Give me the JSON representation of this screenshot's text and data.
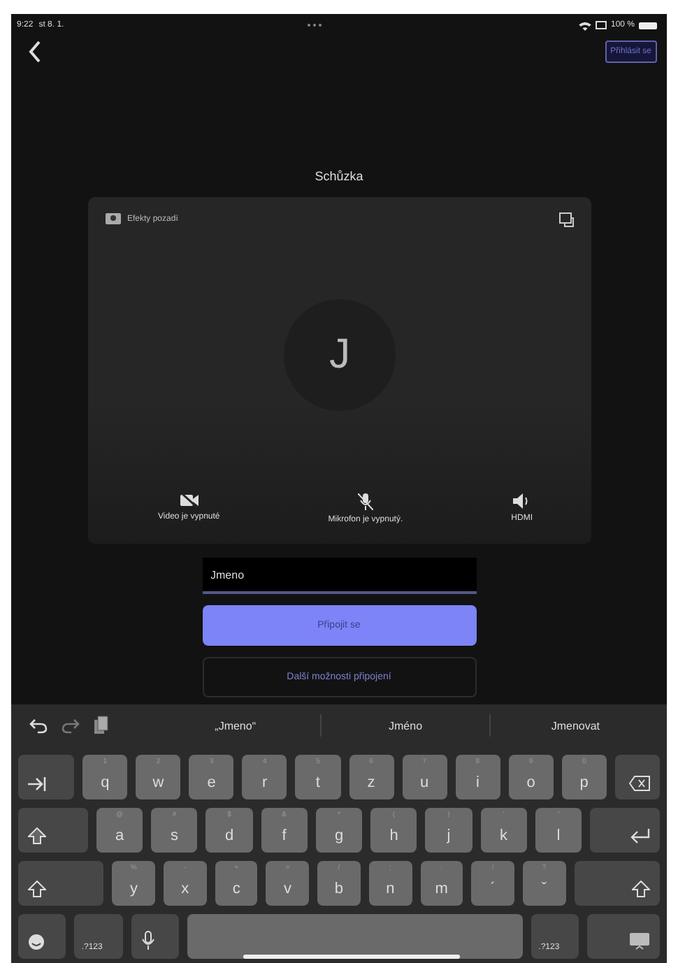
{
  "status_bar": {
    "time": "9:22",
    "date": "st 8. 1.",
    "battery": "100 %"
  },
  "top_bar": {
    "login_button": "Přihlásit se"
  },
  "title": "Schůzka",
  "preview": {
    "background_effects": "Efekty pozadí",
    "avatar_initial": "J",
    "controls": [
      {
        "label": "Video je vypnuté",
        "kind": "video_off"
      },
      {
        "label": "Mikrofon je vypnutý.",
        "kind": "mic_off"
      },
      {
        "label": "HDMI",
        "kind": "speaker"
      }
    ]
  },
  "name_field": {
    "value": "Jmeno"
  },
  "join_button": "Připojit se",
  "more_options_button": "Další možnosti připojení",
  "keyboard": {
    "suggestions": [
      "„Jmeno“",
      "Jméno",
      "Jmenovat"
    ],
    "rows": [
      {
        "keys": [
          {
            "kind": "tab"
          },
          {
            "kind": "letter",
            "label": "q",
            "hint": "1"
          },
          {
            "kind": "letter",
            "label": "w",
            "hint": "2"
          },
          {
            "kind": "letter",
            "label": "e",
            "hint": "3"
          },
          {
            "kind": "letter",
            "label": "r",
            "hint": "4"
          },
          {
            "kind": "letter",
            "label": "t",
            "hint": "5"
          },
          {
            "kind": "letter",
            "label": "z",
            "hint": "6"
          },
          {
            "kind": "letter",
            "label": "u",
            "hint": "7"
          },
          {
            "kind": "letter",
            "label": "i",
            "hint": "8"
          },
          {
            "kind": "letter",
            "label": "o",
            "hint": "9"
          },
          {
            "kind": "letter",
            "label": "p",
            "hint": "0"
          },
          {
            "kind": "backspace"
          }
        ]
      },
      {
        "keys": [
          {
            "kind": "caps"
          },
          {
            "kind": "letter",
            "label": "a",
            "hint": "@"
          },
          {
            "kind": "letter",
            "label": "s",
            "hint": "#"
          },
          {
            "kind": "letter",
            "label": "d",
            "hint": "$"
          },
          {
            "kind": "letter",
            "label": "f",
            "hint": "&"
          },
          {
            "kind": "letter",
            "label": "g",
            "hint": "*"
          },
          {
            "kind": "letter",
            "label": "h",
            "hint": "("
          },
          {
            "kind": "letter",
            "label": "j",
            "hint": ")"
          },
          {
            "kind": "letter",
            "label": "k",
            "hint": "'"
          },
          {
            "kind": "letter",
            "label": "l",
            "hint": "\""
          },
          {
            "kind": "return"
          }
        ]
      },
      {
        "keys": [
          {
            "kind": "shift"
          },
          {
            "kind": "letter",
            "label": "y",
            "hint": "%"
          },
          {
            "kind": "letter",
            "label": "x",
            "hint": "-"
          },
          {
            "kind": "letter",
            "label": "c",
            "hint": "+"
          },
          {
            "kind": "letter",
            "label": "v",
            "hint": "="
          },
          {
            "kind": "letter",
            "label": "b",
            "hint": "/"
          },
          {
            "kind": "letter",
            "label": "n",
            "hint": ";"
          },
          {
            "kind": "letter",
            "label": "m",
            "hint": ":"
          },
          {
            "kind": "letter",
            "label": "´",
            "hint": "!"
          },
          {
            "kind": "letter",
            "label": "ˇ",
            "hint": "?"
          },
          {
            "kind": "shift"
          }
        ]
      },
      {
        "keys": [
          {
            "kind": "emoji"
          },
          {
            "kind": "numbers",
            "label": ".?123"
          },
          {
            "kind": "mic"
          },
          {
            "kind": "space"
          },
          {
            "kind": "numbers",
            "label": ".?123"
          },
          {
            "kind": "hide"
          }
        ]
      }
    ]
  }
}
